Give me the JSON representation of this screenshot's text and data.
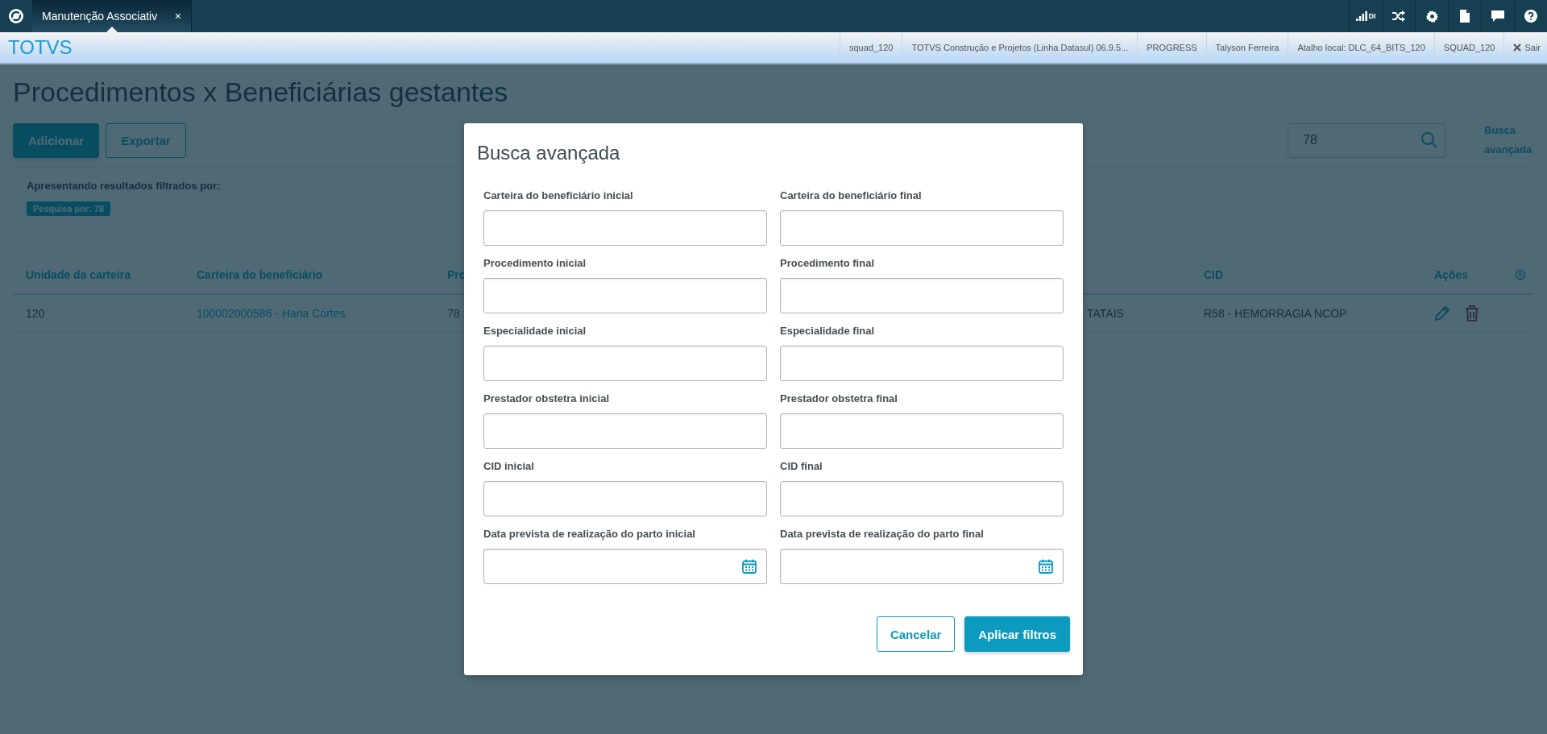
{
  "top_bar": {
    "tab": {
      "label": "Manutenção Associativ",
      "close": "×",
      "selected": true
    },
    "tools": [
      {
        "kind": "signal",
        "label": "DI"
      },
      {
        "kind": "shuffle"
      },
      {
        "kind": "settings"
      },
      {
        "kind": "file"
      },
      {
        "kind": "chat"
      },
      {
        "kind": "help"
      }
    ]
  },
  "header": {
    "brand": "TOTVS",
    "info": [
      "squad_120",
      "TOTVS Construção e Projetos (Linha Datasul) 06.9.5...",
      "PROGRESS",
      "Talyson Ferreira",
      "Atalho local: DLC_64_BITS_120",
      "SQUAD_120"
    ],
    "logout": "Sair"
  },
  "page": {
    "title": "Procedimentos x Beneficiárias gestantes",
    "buttons": [
      {
        "label": "Adicionar",
        "kind": "primary"
      },
      {
        "label": "Exportar",
        "kind": "secondary"
      }
    ],
    "search": {
      "value": "78"
    },
    "advanced_link": "Busca avançada",
    "filter": {
      "caption": "Apresentando resultados filtrados por:",
      "tags": [
        "Pesquisa por: 78"
      ]
    },
    "table": {
      "columns": [
        "Unidade da carteira",
        "Carteira do beneficiário",
        "Pro",
        "",
        "CID",
        "Ações"
      ],
      "rows": [
        {
          "cells": [
            {
              "text": "120",
              "kind": "text"
            },
            {
              "text": "100002000586 - Hana Cortes",
              "kind": "link"
            },
            {
              "text": "78",
              "kind": "text"
            },
            {
              "text": "TATAIS",
              "kind": "text"
            },
            {
              "text": "R58 - HEMORRAGIA NCOP",
              "kind": "text"
            }
          ],
          "actions": [
            {
              "kind": "edit"
            },
            {
              "kind": "delete"
            }
          ]
        }
      ]
    }
  },
  "dialog": {
    "title": "Busca avançada",
    "fields": [
      {
        "label": "Carteira do beneficiário inicial",
        "kind": "text"
      },
      {
        "label": "Carteira do beneficiário final",
        "kind": "text"
      },
      {
        "label": "Procedimento inicial",
        "kind": "text"
      },
      {
        "label": "Procedimento final",
        "kind": "text"
      },
      {
        "label": "Especialidade inicial",
        "kind": "text"
      },
      {
        "label": "Especialidade final",
        "kind": "text"
      },
      {
        "label": "Prestador obstetra inicial",
        "kind": "text"
      },
      {
        "label": "Prestador obstetra final",
        "kind": "text"
      },
      {
        "label": "CID inicial",
        "kind": "text"
      },
      {
        "label": "CID final",
        "kind": "text"
      },
      {
        "label": "Data prevista de realização do parto inicial",
        "kind": "date"
      },
      {
        "label": "Data prevista de realização do parto final",
        "kind": "date"
      }
    ],
    "buttons": [
      {
        "label": "Cancelar",
        "kind": "secondary"
      },
      {
        "label": "Aplicar filtros",
        "kind": "primary"
      }
    ]
  }
}
